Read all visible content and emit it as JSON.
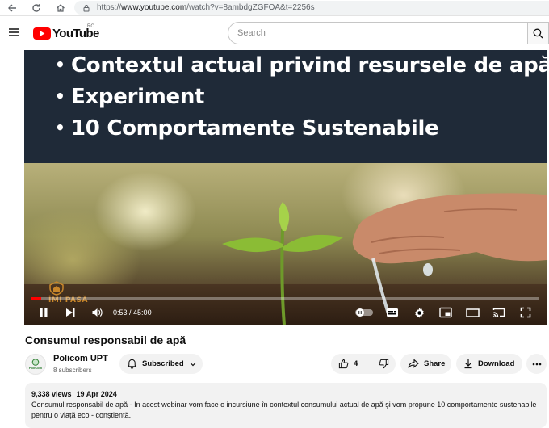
{
  "browser": {
    "url_prefix": "https://",
    "url_host": "www.youtube.com",
    "url_path": "/watch?v=8ambdgZGFOA&t=2256s"
  },
  "header": {
    "logo_text": "YouTube",
    "region": "RO",
    "search_placeholder": "Search"
  },
  "player": {
    "slide_bullets": [
      "Contextul actual privind resursele de apă",
      "Experiment",
      "10 Comportamente Sustenabile"
    ],
    "watermark_text": "ÎMI PASĂ",
    "time_current": "0:53",
    "time_separator": " / ",
    "time_total": "45:00",
    "progress_fraction": 0.0196
  },
  "video": {
    "title": "Consumul responsabil de apă"
  },
  "channel": {
    "name": "Policom UPT",
    "subscribers": "8 subscribers",
    "avatar_text": "PoliCom"
  },
  "actions": {
    "subscribed_label": "Subscribed",
    "like_count": "4",
    "share_label": "Share",
    "download_label": "Download"
  },
  "description": {
    "views": "9,338 views",
    "date": "19 Apr 2024",
    "text": "Consumul responsabil de apă - În acest webinar vom face o incursiune în contextul consumului actual de apă și vom propune 10 comportamente sustenabile pentru o viață eco - conștientă."
  },
  "colors": {
    "brand_red": "#ff0000",
    "slide_bg": "#1f2a38",
    "pill_bg": "#f2f2f2"
  }
}
